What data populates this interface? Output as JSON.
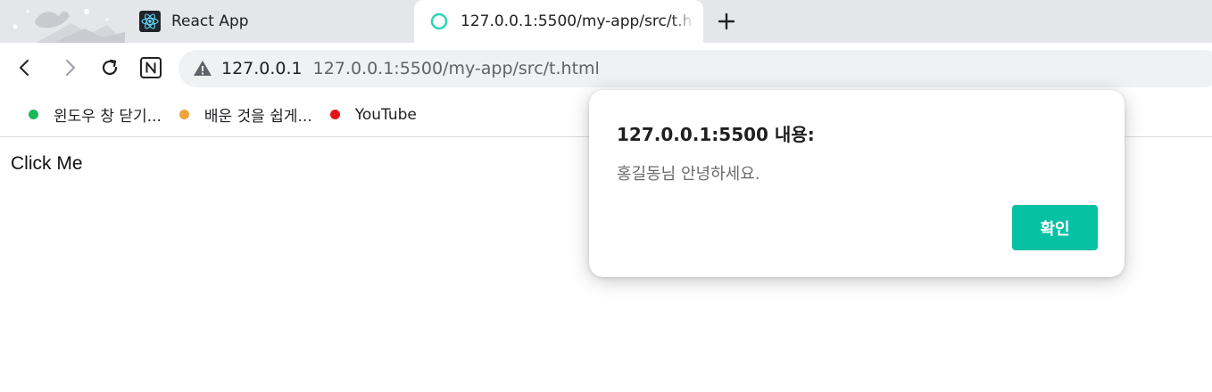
{
  "browser": {
    "tabs": [
      {
        "title": "React App",
        "active": false,
        "icon": "react-icon"
      },
      {
        "title": "127.0.0.1:5500/my-app/src/t.html",
        "active": true,
        "icon": "loading-ring-icon"
      }
    ],
    "address_bar": {
      "security_icon": "not-secure-warning-icon",
      "host": "127.0.0.1",
      "url": "127.0.0.1:5500/my-app/src/t.html"
    },
    "bookmarks": [
      {
        "label": "윈도우 창 닫기...",
        "dot_color": "#1bb85a"
      },
      {
        "label": "배운 것을 쉽게...",
        "dot_color": "#f0a33d"
      },
      {
        "label": "YouTube",
        "dot_color": "#e31414"
      }
    ],
    "accent_color": "#06c1a4"
  },
  "page": {
    "content_text": "Click Me"
  },
  "alert": {
    "title": "127.0.0.1:5500 내용:",
    "message": "홍길동님 안녕하세요.",
    "ok_label": "확인"
  }
}
